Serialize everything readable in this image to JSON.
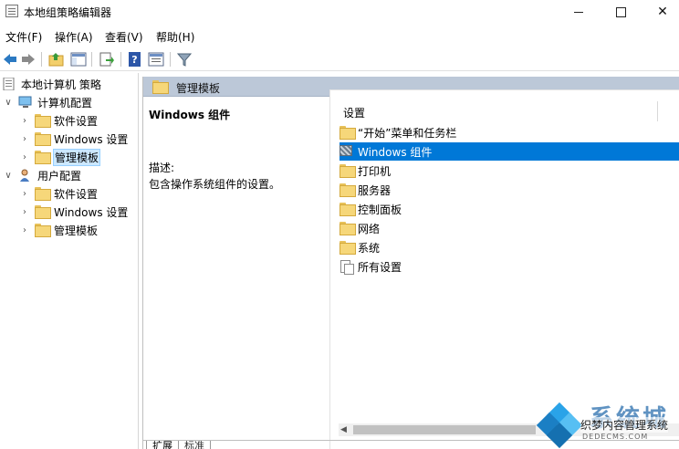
{
  "window": {
    "title": "本地组策略编辑器",
    "close_glyph": "✕"
  },
  "menu": {
    "file": "文件(F)",
    "action": "操作(A)",
    "view": "查看(V)",
    "help": "帮助(H)"
  },
  "toolbar": {
    "icons": [
      "back-arrow-icon",
      "forward-arrow-icon",
      "up-folder-icon",
      "show-hide-tree-icon",
      "export-list-icon",
      "help-icon",
      "properties-icon",
      "filter-icon"
    ]
  },
  "tree": {
    "root": "本地计算机 策略",
    "computer_config": "计算机配置",
    "cc_software": "软件设置",
    "cc_windows": "Windows 设置",
    "cc_admin": "管理模板",
    "user_config": "用户配置",
    "uc_software": "软件设置",
    "uc_windows": "Windows 设置",
    "uc_admin": "管理模板",
    "expanded_glyph": "∨",
    "collapsed_glyph": "›"
  },
  "right_header": {
    "title": "管理模板"
  },
  "description": {
    "title": "Windows 组件",
    "label": "描述:",
    "text": "包含操作系统组件的设置。"
  },
  "list": {
    "column": "设置",
    "items": [
      "“开始”菜单和任务栏",
      "Windows 组件",
      "打印机",
      "服务器",
      "控制面板",
      "网络",
      "系统",
      "所有设置"
    ],
    "selected_index": 1
  },
  "scrollbar": {
    "left_arrow": "◀"
  },
  "tabs": {
    "extended": "扩展",
    "standard": "标准"
  },
  "watermark": {
    "big": "系统城",
    "mid": "织梦内容管理系统",
    "small": "DEDECMS.COM"
  },
  "colors": {
    "selection": "#0078d7",
    "header_bar": "#bcc8d8",
    "tree_selection": "#cce8ff"
  }
}
